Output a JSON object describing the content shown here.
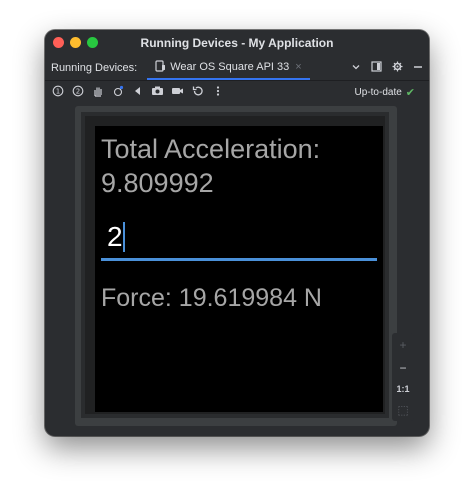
{
  "window": {
    "title": "Running Devices - My Application"
  },
  "tabbar": {
    "label": "Running Devices:",
    "tab_label": "Wear OS Square API 33",
    "tab_close": "×",
    "icons": [
      "device-icon",
      "chevron-down-icon",
      "layout-icon",
      "gear-icon",
      "minimize-icon"
    ]
  },
  "toolbar": {
    "icons": [
      "button-1-icon",
      "button-2-icon",
      "palm-icon",
      "tilt-icon",
      "back-icon",
      "camera-icon",
      "video-icon",
      "reset-icon",
      "more-icon"
    ],
    "status": "Up-to-date",
    "status_color": "#5fb865"
  },
  "device": {
    "accel_label": "Total Acceleration:",
    "accel_value": "9.809992",
    "mass_input_value": "2",
    "force_text": "Force: 19.619984 N",
    "accent_color": "#4a90d9"
  },
  "zoom": {
    "plus": "+",
    "minus": "−",
    "ratio": "1:1",
    "fit": "⬚"
  }
}
